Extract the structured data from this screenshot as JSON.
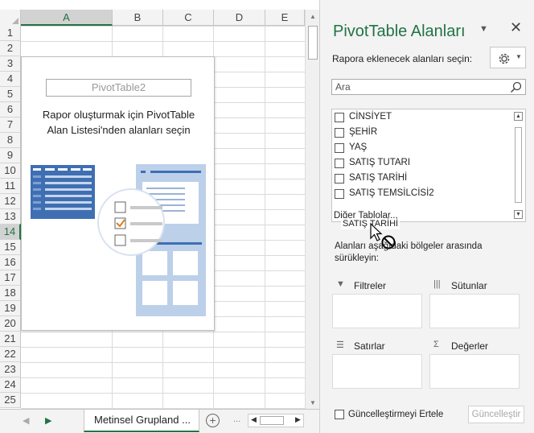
{
  "sheet": {
    "columns": [
      "A",
      "B",
      "C",
      "D",
      "E"
    ],
    "rows": [
      "1",
      "2",
      "3",
      "4",
      "5",
      "6",
      "7",
      "8",
      "9",
      "10",
      "11",
      "12",
      "13",
      "14",
      "15",
      "16",
      "17",
      "18",
      "19",
      "20",
      "21",
      "22",
      "23",
      "24",
      "25"
    ],
    "selected_column": "A",
    "selected_row": "14"
  },
  "pivot": {
    "name": "PivotTable2",
    "message_line1": "Rapor oluşturmak için PivotTable",
    "message_line2": "Alan Listesi'nden alanları seçin"
  },
  "pane": {
    "title": "PivotTable Alanları",
    "choose_label": "Rapora eklenecek alanları seçin:",
    "search_placeholder": "Ara",
    "fields": [
      {
        "label": "CİNSİYET",
        "checked": false
      },
      {
        "label": "ŞEHİR",
        "checked": false
      },
      {
        "label": "YAŞ",
        "checked": false
      },
      {
        "label": "SATIŞ TUTARI",
        "checked": false
      },
      {
        "label": "SATIŞ TARİHİ",
        "checked": false
      },
      {
        "label": "SATIŞ TEMSİLCİSİ2",
        "checked": false
      }
    ],
    "more_tables": "Diğer Tablolar...",
    "dragging_field": "SATIŞ TARİHİ",
    "drag_hint": "Alanları aşağıdaki bölgeler arasında sürükleyin:",
    "areas": {
      "filters": "Filtreler",
      "columns": "Sütunlar",
      "rows": "Satırlar",
      "values": "Değerler"
    },
    "defer_label": "Güncelleştirmeyi Ertele",
    "update_label": "Güncelleştir"
  },
  "tabs": {
    "sheet_name": "Metinsel Grupland ...",
    "add_sheet": "+",
    "more": "..."
  },
  "colors": {
    "accent": "#217346",
    "illustration": "#3f6fb3",
    "checkmark": "#e07b24"
  }
}
